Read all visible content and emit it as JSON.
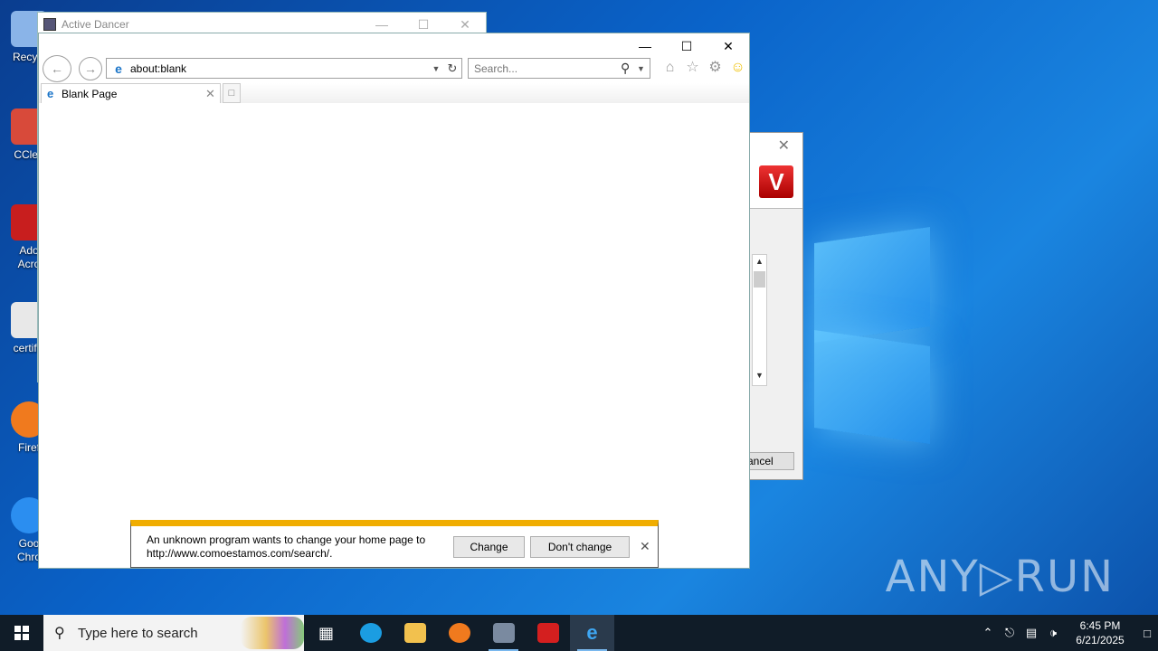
{
  "desktop": {
    "icons": [
      {
        "label": "Recycl",
        "color": "#8ab4e8"
      },
      {
        "label": "CClea",
        "color": "#d84a3a"
      },
      {
        "label": "Ado\nAcro",
        "color": "#c81e1e"
      },
      {
        "label": "certific",
        "color": "#e8e8e8"
      },
      {
        "label": "Firef",
        "color": "#f07a1e"
      },
      {
        "label": "Goo\nChro",
        "color": "#2b8ef0"
      }
    ],
    "watermark": "ANY▷RUN"
  },
  "active_dancer": {
    "title": "Active Dancer"
  },
  "installer": {
    "cancel_label": "ancel",
    "logo_letter": "V"
  },
  "ie": {
    "address": "about:blank",
    "search_placeholder": "Search...",
    "tab_label": "Blank Page"
  },
  "notification": {
    "message": "An unknown program wants to change your home page to http://www.comoestamos.com/search/.",
    "change_label": "Change",
    "dont_change_label": "Don't change"
  },
  "taskbar": {
    "search_placeholder": "Type here to search",
    "time": "6:45 PM",
    "date": "6/21/2025"
  }
}
